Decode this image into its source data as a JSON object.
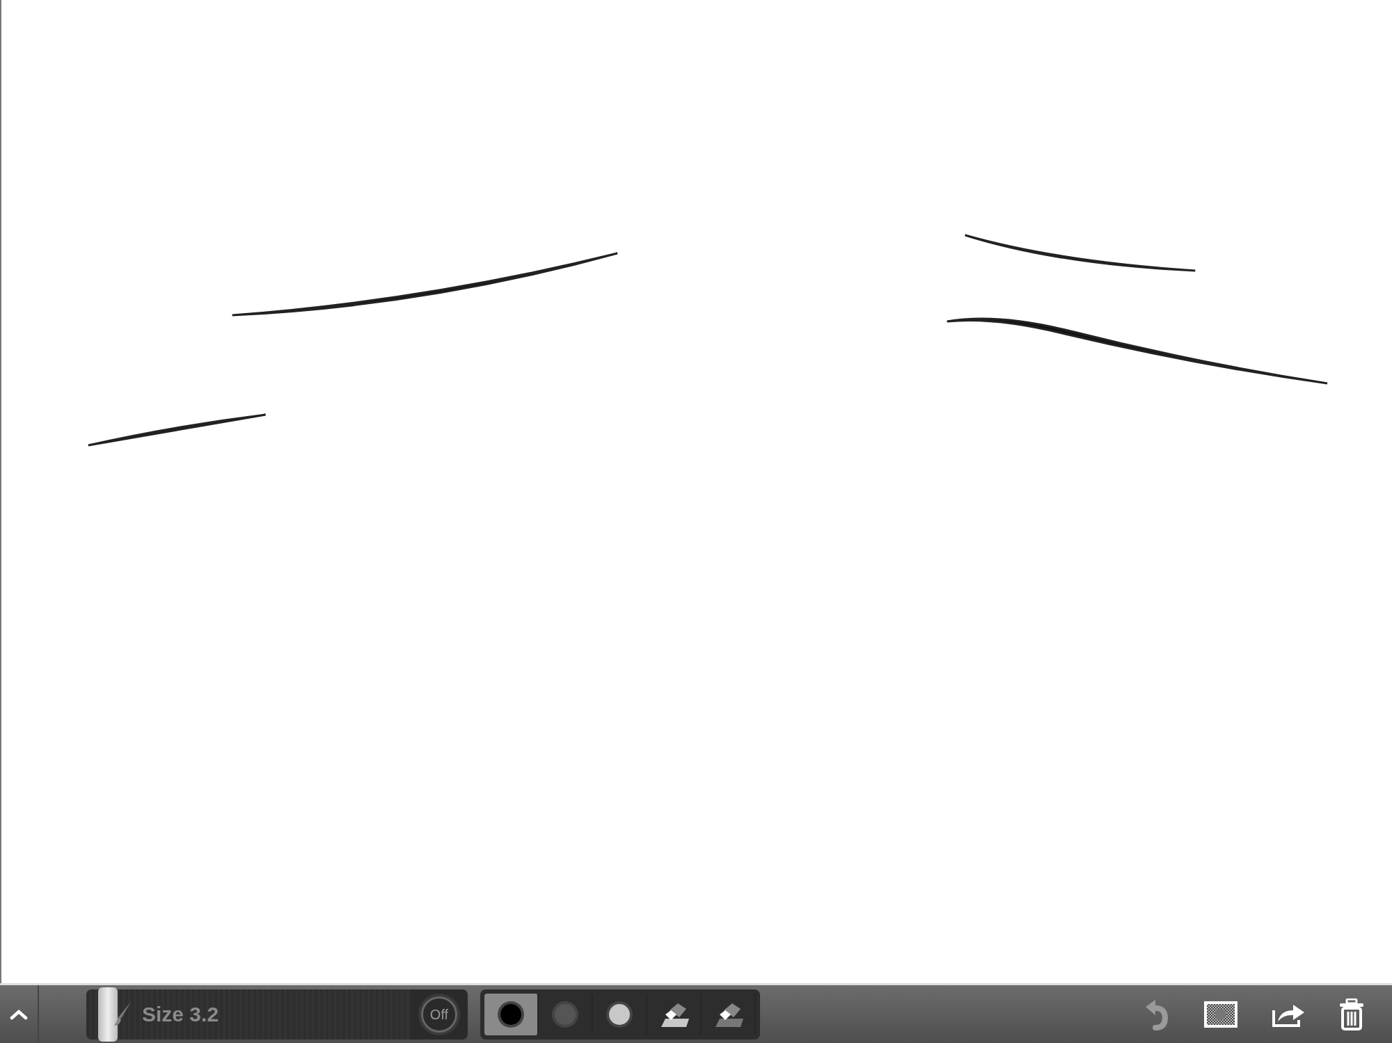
{
  "toolbar": {
    "brush_size": {
      "label": "Size 3.2",
      "level": 0.02
    },
    "opacity_toggle": {
      "label": "Off",
      "on": false
    },
    "tools": [
      {
        "kind": "color",
        "color": "#000000",
        "selected": true
      },
      {
        "kind": "color",
        "color": "#555555",
        "selected": false
      },
      {
        "kind": "color",
        "color": "#c8c8c8",
        "selected": false
      },
      {
        "kind": "eraser",
        "selected": false
      },
      {
        "kind": "eraser-soft",
        "selected": false
      }
    ],
    "undo": {
      "disabled": true
    }
  }
}
